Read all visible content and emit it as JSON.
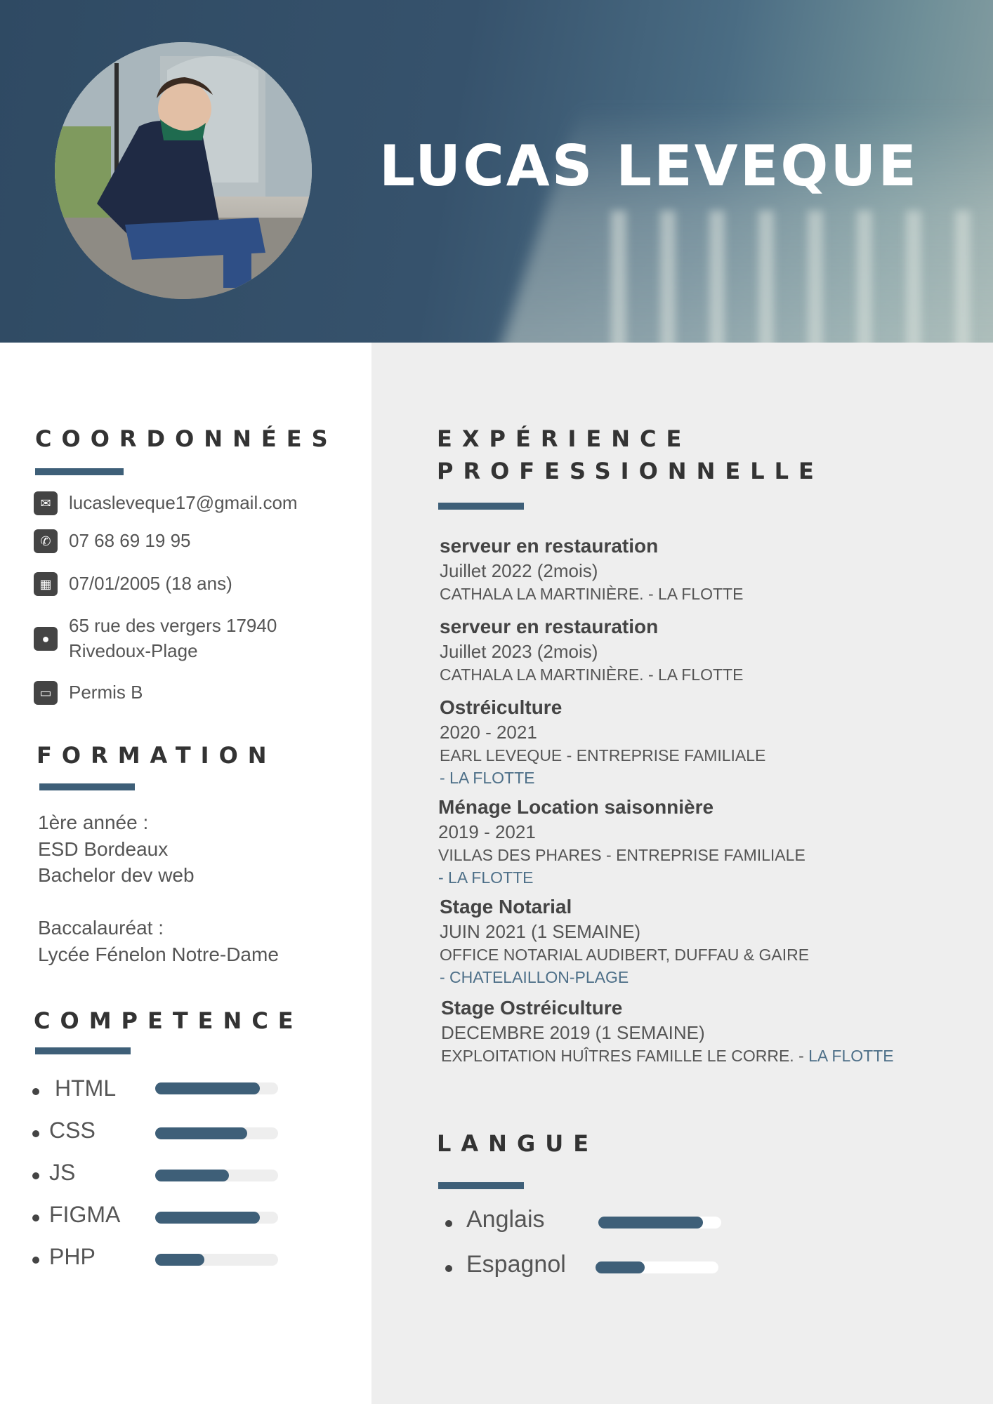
{
  "header": {
    "name": "LUCAS LEVEQUE"
  },
  "contact": {
    "title": "COORDONNÉES",
    "email": "lucasleveque17@gmail.com",
    "phone": "07 68 69 19 95",
    "birth": "07/01/2005 (18 ans)",
    "address": "65 rue des vergers 17940 Rivedoux-Plage",
    "license": "Permis B"
  },
  "formation": {
    "title": "FORMATION",
    "lines": [
      "1ère année :",
      "ESD Bordeaux",
      "Bachelor dev web",
      "Baccalauréat :",
      "Lycée Fénelon Notre-Dame"
    ]
  },
  "competence": {
    "title": "COMPETENCE",
    "skills": [
      {
        "name": "HTML",
        "level": 0.85
      },
      {
        "name": "CSS",
        "level": 0.75
      },
      {
        "name": "JS",
        "level": 0.6
      },
      {
        "name": "FIGMA",
        "level": 0.85
      },
      {
        "name": "PHP",
        "level": 0.4
      }
    ]
  },
  "experience": {
    "title_line1": "EXPÉRIENCE",
    "title_line2": "PROFESSIONNELLE",
    "items": [
      {
        "title": "serveur en restauration",
        "date": "Juillet 2022 (2mois)",
        "company": "CATHALA   LA MARTINIÈRE. - LA FLOTTE",
        "location": ""
      },
      {
        "title": "serveur en restauration",
        "date": "Juillet 2023 (2mois)",
        "company": "CATHALA   LA MARTINIÈRE. - LA FLOTTE",
        "location": ""
      },
      {
        "title": "Ostréiculture",
        "date": "2020 - 2021",
        "company": "EARL LEVEQUE - ENTREPRISE FAMILIALE",
        "location": "- LA FLOTTE"
      },
      {
        "title": "Ménage Location saisonnière",
        "date": "2019 - 2021",
        "company": "VILLAS DES PHARES - ENTREPRISE FAMILIALE",
        "location": "- LA FLOTTE"
      },
      {
        "title": "Stage Notarial",
        "date": "JUIN 2021 (1 SEMAINE)",
        "company": "OFFICE NOTARIAL AUDIBERT, DUFFAU & GAIRE",
        "location": "- CHATELAILLON-PLAGE"
      },
      {
        "title": "Stage Ostréiculture",
        "date": "DECEMBRE 2019 (1 SEMAINE)",
        "company": "EXPLOITATION HUÎTRES FAMILLE LE CORRE. - ",
        "location": "LA FLOTTE"
      }
    ]
  },
  "langue": {
    "title": "LANGUE",
    "items": [
      {
        "name": "Anglais",
        "level": 0.85
      },
      {
        "name": "Espagnol",
        "level": 0.4
      }
    ]
  },
  "colors": {
    "accent": "#3e5f78",
    "header_bg": "#2f4a63",
    "panel_bg": "#eeeeee",
    "text": "#555555"
  },
  "icons": [
    "envelope-icon",
    "phone-icon",
    "calendar-icon",
    "location-pin-icon",
    "id-card-icon"
  ]
}
